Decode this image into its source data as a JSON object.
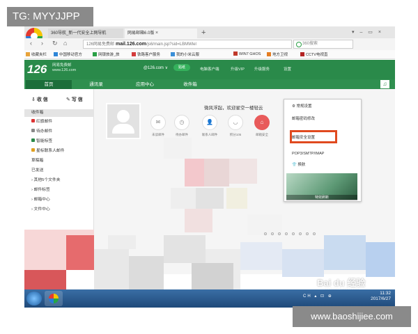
{
  "overlay": {
    "tg_label": "TG: MYYJJPP",
    "site_label": "www.baoshijiee.com"
  },
  "browser": {
    "tab1_title": "360导航_新一代安全上网导航",
    "tab2_title": "网易邮箱6.0版",
    "tab_close": "×",
    "new_tab": "+",
    "win_controls": "▾ – ▭ ×",
    "url_prefix": "126网易免费邮",
    "url_main": "mail.126.com",
    "url_path": "/js6/main.jsp?sid=LBMWlel",
    "search_placeholder": "360搜索",
    "nav_back": "‹",
    "nav_forward": "›",
    "nav_reload": "↻",
    "nav_home": "⌂",
    "bookmarks": [
      "收藏夹栏",
      "中国移动官方",
      "网银旅游_旅",
      "铁路客户服务",
      "我的小米云服",
      "WIN7 GHOS",
      "地方卫视",
      "CCTV电视直"
    ],
    "bookmark_colors": [
      "#e8a33a",
      "#2e86d8",
      "#2aa046",
      "#d43c3c",
      "#3a8fd8",
      "#c0392b",
      "#e57d22",
      "#b32424"
    ]
  },
  "mail": {
    "logo_number": "126",
    "logo_sub1": "网易免费邮",
    "logo_sub2": "www.126.com",
    "account": "@126.com ∨",
    "vip_label": "贴纸",
    "header_links": [
      "电脑客户端",
      "升级VIP",
      "升级服务",
      "设置"
    ],
    "tabs": [
      "首页",
      "通讯录",
      "应用中心",
      "收件箱"
    ],
    "music_icon": "♫",
    "compose_label": "收 信",
    "write_label": "写 信",
    "sidebar_items": [
      "收件箱",
      "红旗邮件",
      "待办邮件",
      "智能标签",
      "星标联系人邮件",
      "草稿箱",
      "已发送",
      "其他5个文件夹",
      "邮件标签",
      "邮箱中心",
      "文件中心"
    ],
    "sidebar_item_colors": [
      "",
      "#d33",
      "#888",
      "#2a8a4a",
      "#e0a020",
      "",
      "",
      "",
      "",
      "",
      ""
    ],
    "welcome_text": "微风浮起，欢迎星空一楼轻云",
    "quick_actions": [
      "未读邮件",
      "待办邮件",
      "联系人邮件",
      "积分105",
      "邮箱安全"
    ],
    "quick_action_icons": [
      "✉",
      "◷",
      "👤",
      "◡",
      "⌂"
    ]
  },
  "settings_menu": {
    "header": "常规设置",
    "items": [
      "邮箱密码修改",
      "",
      "邮箱安全设置",
      "",
      "POP3/SMTP/IMAP",
      "换肤"
    ],
    "thumb_label": "特效刷新"
  },
  "taskbar": {
    "time": "11:32",
    "date": "2017/6/27",
    "tray_text": "CH ▴ ⊡ ⊕"
  },
  "watermark": {
    "brand": "Bai du 经验",
    "url": "jingyan.baidu.com"
  },
  "colors": {
    "mail_green": "#2a8a4a",
    "highlight_red": "#e04a1f"
  }
}
